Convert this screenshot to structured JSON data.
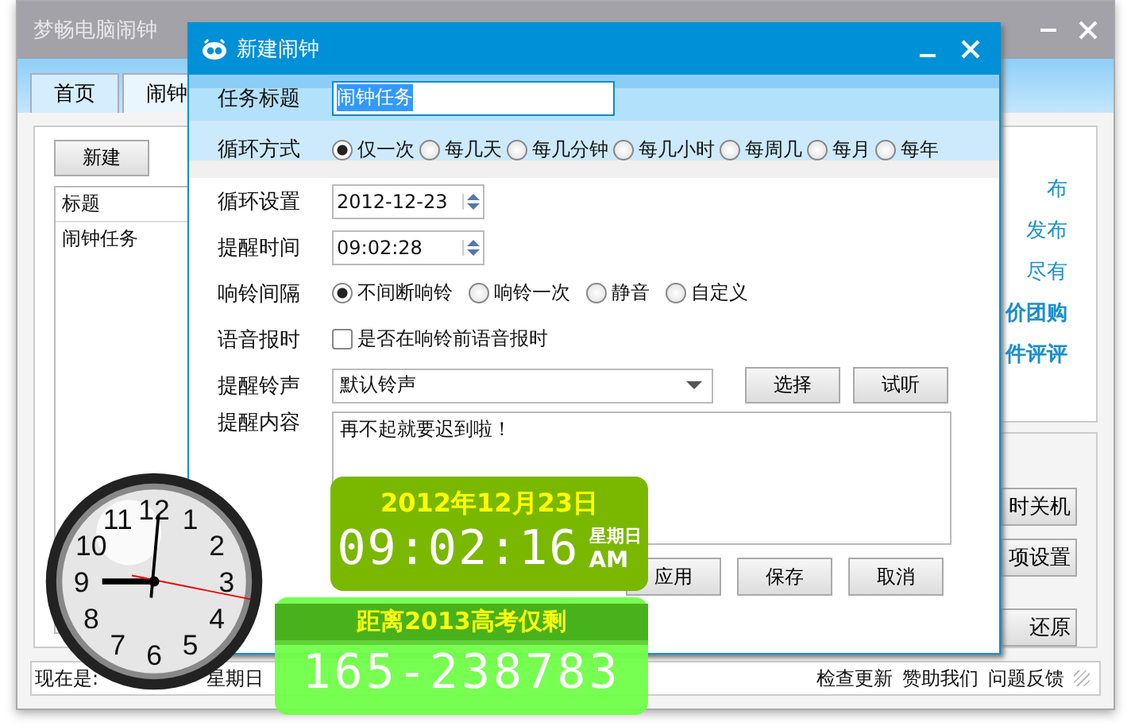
{
  "main_window": {
    "title": "梦畅电脑闹钟",
    "tabs": [
      {
        "label": "首页",
        "selected": false
      },
      {
        "label": "闹钟",
        "selected": true
      }
    ],
    "new_button": "新建",
    "list": {
      "column": "标题",
      "rows": [
        "闹钟任务"
      ]
    },
    "links": [
      "布",
      "发布",
      "尽有",
      "价团购",
      "件评评"
    ],
    "buttons": [
      "时关机",
      "项设置",
      "还原"
    ],
    "status_left": "现在是:",
    "status_weekday": "星期日",
    "status_links": [
      "检查更新",
      "赞助我们",
      "问题反馈"
    ]
  },
  "dialog": {
    "title": "新建闹钟",
    "task_title": {
      "label": "任务标题",
      "value": "闹钟任务"
    },
    "repeat": {
      "label": "循环方式",
      "options": [
        {
          "label": "仅一次",
          "selected": true
        },
        {
          "label": "每几天",
          "selected": false
        },
        {
          "label": "每几分钟",
          "selected": false
        },
        {
          "label": "每几小时",
          "selected": false
        },
        {
          "label": "每周几",
          "selected": false
        },
        {
          "label": "每月",
          "selected": false
        },
        {
          "label": "每年",
          "selected": false
        }
      ]
    },
    "repeat_setting": {
      "label": "循环设置",
      "value": "2012-12-23"
    },
    "remind_time": {
      "label": "提醒时间",
      "value": "09:02:28"
    },
    "ring_interval": {
      "label": "响铃间隔",
      "options": [
        {
          "label": "不间断响铃",
          "selected": true
        },
        {
          "label": "响铃一次",
          "selected": false
        },
        {
          "label": "静音",
          "selected": false
        },
        {
          "label": "自定义",
          "selected": false
        }
      ]
    },
    "voice": {
      "label": "语音报时",
      "text": "是否在响铃前语音报时",
      "checked": false
    },
    "ringtone": {
      "label": "提醒铃声",
      "value": "默认铃声",
      "buttons": [
        "选择",
        "试听"
      ]
    },
    "content": {
      "label": "提醒内容",
      "value": "再不起就要迟到啦！"
    },
    "buttons": [
      "应用",
      "保存",
      "取消"
    ]
  },
  "clock": {
    "numerals": [
      "11",
      "12",
      "1",
      "10",
      "2",
      "9",
      "3",
      "8",
      "4",
      "7",
      "6",
      "5"
    ]
  },
  "date_widget": {
    "date": "2012年12月23日",
    "time": "09:02:16",
    "weekday": "星期日",
    "ampm": "AM"
  },
  "countdown_widget": {
    "title": "距离2013高考仅剩",
    "value": "165-238783"
  }
}
